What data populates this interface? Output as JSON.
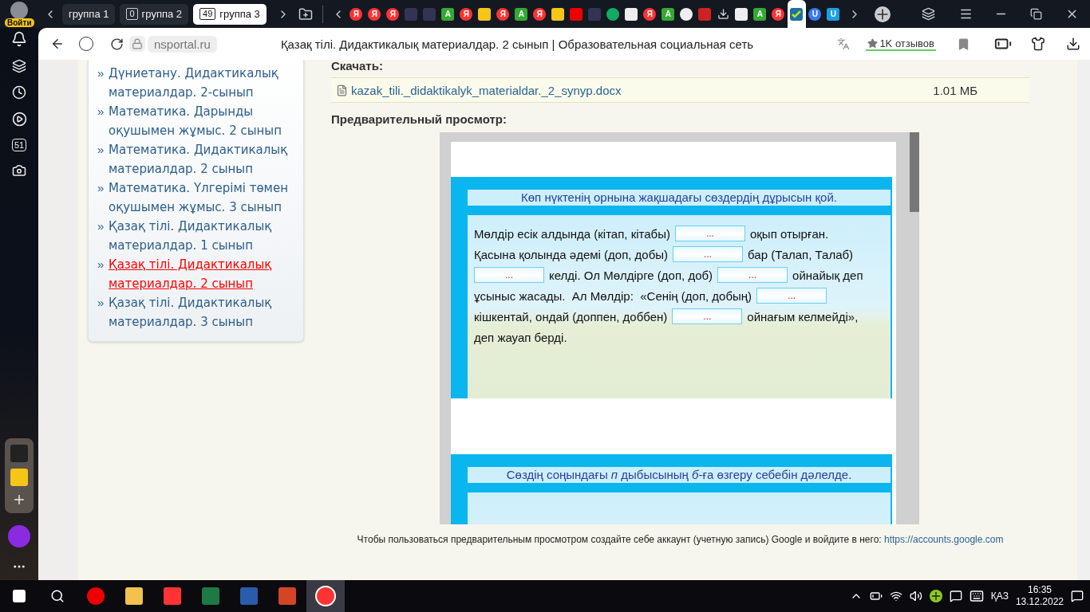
{
  "browser": {
    "profile_label": "Войти",
    "tab_groups": [
      {
        "label": "группа 1",
        "selected": false
      },
      {
        "count": "0",
        "label": "группа 2",
        "selected": false
      },
      {
        "count": "49",
        "label": "группа 3",
        "selected": true
      }
    ],
    "site_tabs": [
      {
        "kind": "ya",
        "letter": "Я",
        "selected": false
      },
      {
        "kind": "ya",
        "letter": "Я",
        "selected": false
      },
      {
        "kind": "ya",
        "letter": "Я",
        "selected": false
      },
      {
        "kind": "hand",
        "selected": false
      },
      {
        "kind": "hand",
        "selected": false
      },
      {
        "kind": "a",
        "letter": "A",
        "selected": false
      },
      {
        "kind": "ya",
        "letter": "Я",
        "selected": false
      },
      {
        "kind": "image",
        "selected": false
      },
      {
        "kind": "ya",
        "letter": "Я",
        "selected": false
      },
      {
        "kind": "a",
        "letter": "A",
        "selected": false
      },
      {
        "kind": "ya",
        "letter": "Я",
        "selected": false
      },
      {
        "kind": "image",
        "selected": false
      },
      {
        "kind": "video",
        "selected": false
      },
      {
        "kind": "hand",
        "selected": false
      },
      {
        "kind": "globe",
        "selected": false
      },
      {
        "kind": "doc",
        "selected": false
      },
      {
        "kind": "ya",
        "letter": "Я",
        "selected": false
      },
      {
        "kind": "a",
        "letter": "A",
        "selected": false
      },
      {
        "kind": "clock",
        "selected": false
      },
      {
        "kind": "shield",
        "selected": false
      },
      {
        "kind": "download",
        "selected": false
      },
      {
        "kind": "doc",
        "selected": false
      },
      {
        "kind": "a",
        "letter": "A",
        "selected": false
      },
      {
        "kind": "ya",
        "letter": "Я",
        "selected": false
      },
      {
        "kind": "check",
        "selected": true
      },
      {
        "kind": "u",
        "letter": "U",
        "selected": false
      },
      {
        "kind": "u-outline",
        "letter": "U",
        "selected": false
      }
    ],
    "address": "nsportal.ru",
    "page_title": "Қазақ тілі. Дидактикалық материалдар. 2 сынып | Образовательная социальная сеть",
    "reviews": "1K отзывов"
  },
  "side_panel": {
    "badge": "51"
  },
  "sidebar": {
    "items": [
      {
        "bullet": "»",
        "text": "Дүниетану. Дидактикалық материалдар. 2-сынып",
        "selected": false
      },
      {
        "bullet": "»",
        "text": "Математика. Дарынды оқушымен жұмыс. 2 сынып",
        "selected": false
      },
      {
        "bullet": "»",
        "text": "Математика. Дидактикалық материалдар. 2 сынып",
        "selected": false
      },
      {
        "bullet": "»",
        "text": "Математика. Үлгерімі төмен оқушымен жұмыс. 3 сынып",
        "selected": false
      },
      {
        "bullet": "»",
        "text": "Қазақ тілі. Дидактикалық материалдар. 1 сынып",
        "selected": false
      },
      {
        "bullet": "»",
        "text": "Қазақ тілі. Дидактикалық материалдар. 2 сынып",
        "selected": true
      },
      {
        "bullet": "»",
        "text": "Қазақ тілі. Дидактикалық материалдар. 3 сынып",
        "selected": false
      }
    ]
  },
  "download": {
    "heading": "Скачать:",
    "file_name": "kazak_tili._didaktikalyk_materialdar._2_synyp.docx",
    "file_size": "1.01 МБ"
  },
  "preview": {
    "heading": "Предварительный просмотр:",
    "exercises": [
      {
        "title": "Көп нүктенің орнына жақшадағы сөздердің дұрысын қой.",
        "lines": [
          [
            {
              "kind": "text",
              "text": "Мөлдір есік алдында (кітап, кітабы)"
            },
            {
              "kind": "blank",
              "text": "..."
            },
            {
              "kind": "text",
              "text": "оқып отырған."
            }
          ],
          [
            {
              "kind": "text",
              "text": "Қасына қолында әдемі (доп, добы)"
            },
            {
              "kind": "blank",
              "text": "..."
            },
            {
              "kind": "text",
              "text": "бар (Талап, Талаб)"
            }
          ],
          [
            {
              "kind": "blank",
              "text": "..."
            },
            {
              "kind": "text",
              "text": "келді. Ол Мөлдірге (доп, доб)"
            },
            {
              "kind": "blank",
              "text": "..."
            },
            {
              "kind": "text",
              "text": "ойнайық деп"
            }
          ],
          [
            {
              "kind": "text",
              "text": "ұсыныс жасады.  Ал Мөлдір:  «Сенің (доп, добың)"
            },
            {
              "kind": "blank",
              "text": "..."
            }
          ],
          [
            {
              "kind": "text",
              "text": "кішкентай, ондай (доппен, доббен)"
            },
            {
              "kind": "blank",
              "text": "..."
            },
            {
              "kind": "text",
              "text": "ойнағым келмейді»,"
            }
          ],
          [
            {
              "kind": "text",
              "text": "деп жауап берді."
            }
          ]
        ]
      },
      {
        "title": "Сөздің соңындағы *п* дыбысының *б*-ға өзгеру себебін дәлелде."
      }
    ]
  },
  "note": {
    "text": "Чтобы пользоваться предварительным просмотром создайте себе аккаунт (учетную запись) Google и войдите в него:",
    "link": "https://accounts.google.com"
  },
  "taskbar": {
    "language": "ҚАЗ",
    "time": "16:35",
    "date": "13.12.2022"
  }
}
